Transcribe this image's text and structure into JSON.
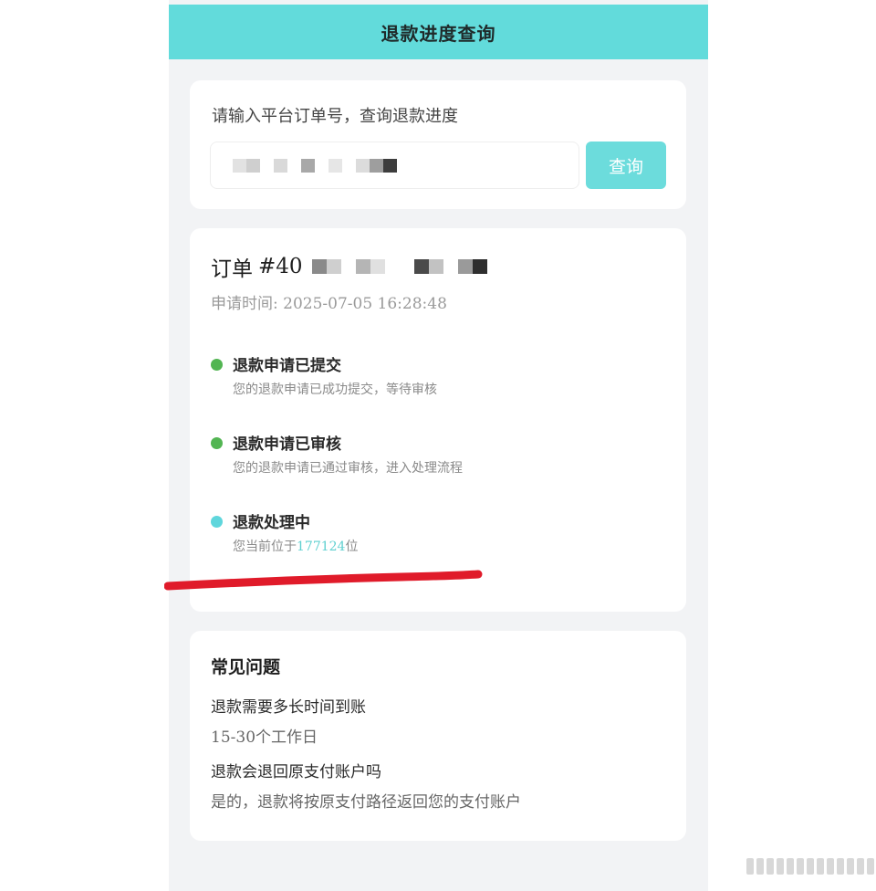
{
  "header": {
    "title": "退款进度查询"
  },
  "search": {
    "hint": "请输入平台订单号，查询退款进度",
    "button_label": "查询"
  },
  "order": {
    "label": "订单",
    "number_prefix": "#40",
    "apply_time": "申请时间: 2025-07-05 16:28:48",
    "steps": [
      {
        "title": "退款申请已提交",
        "desc": "您的退款申请已成功提交，等待审核",
        "color": "#52b552"
      },
      {
        "title": "退款申请已审核",
        "desc": "您的退款申请已通过审核，进入处理流程",
        "color": "#52b552"
      },
      {
        "title": "退款处理中",
        "desc_prefix": "您当前位于",
        "queue_position": "177124",
        "desc_suffix": "位",
        "color": "#5fd6dc"
      }
    ]
  },
  "faq": {
    "title": "常见问题",
    "items": [
      {
        "q": "退款需要多长时间到账",
        "a": "15-30个工作日"
      },
      {
        "q": "退款会退回原支付账户吗",
        "a": "是的，退款将按原支付路径返回您的支付账户"
      }
    ]
  },
  "colors": {
    "header_bg": "#62dbdb",
    "button_bg": "#6cdcdc",
    "success_dot": "#52b552",
    "processing_dot": "#5fd6dc",
    "annotation_red": "#e01b2a"
  }
}
